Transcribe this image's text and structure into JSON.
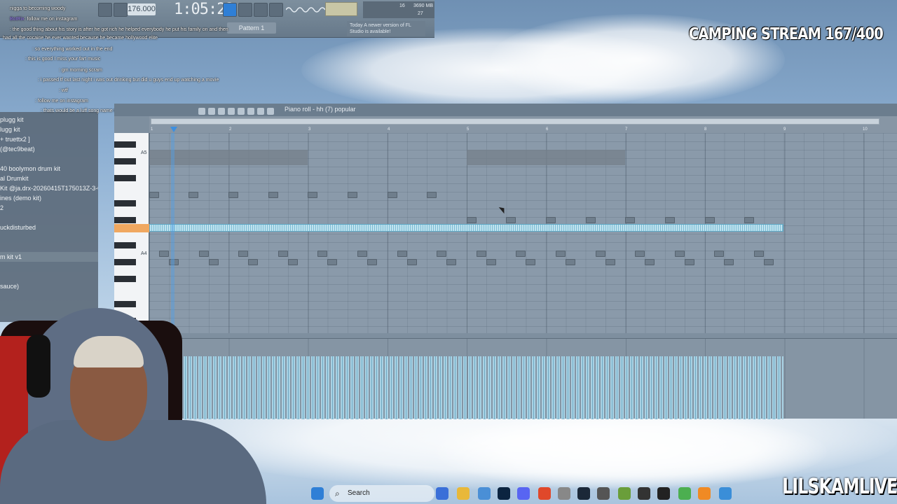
{
  "overlay": {
    "stream_title": "CAMPING STREAM 167/400",
    "watermark": "LILSKAMLIVE"
  },
  "toolbar": {
    "tempo": "176.000",
    "time": "1:05:22",
    "pattern_label": "Pattern 1",
    "cpu_voices": "16",
    "cpu_mem": "3690 MB",
    "cpu_poly": "27",
    "news_date": "Today",
    "news_text": "A newer version of FL Studio is available!"
  },
  "chat": [
    {
      "text": "nigga to becoming woody"
    },
    {
      "user": "BotRix",
      "text": ": follow me on instagram"
    },
    {
      "user": "",
      "text": ": the good thing about his story is after he got rich he helped everybody he put his family on and then"
    },
    {
      "user": "",
      "text": "had all the cocaine he ever wanted because he became hollywood elite"
    },
    {
      "user": "",
      "text": ": so everything worked out in the end"
    },
    {
      "user": "",
      "text": ": this is good I miss your fart music"
    },
    {
      "user": "",
      "text": ": gm morning scram"
    },
    {
      "user": "",
      "text": ": i passed tf out last night i was out drinking but did u guys end up watching a movie"
    },
    {
      "user": "",
      "text": ": wtf"
    },
    {
      "user": "",
      "text": ": follow me on instagram"
    },
    {
      "user": "",
      "text": ": thats would be a luff song name tool im broke my sex robots"
    }
  ],
  "browser": {
    "items": [
      {
        "label": "plugg kit"
      },
      {
        "label": "lugg kit"
      },
      {
        "label": "+ truettx2 ]"
      },
      {
        "label": "(@tec9beat)"
      },
      {
        "label": "40 boolymon drum kit"
      },
      {
        "label": "al Drumkit"
      },
      {
        "label": "Kit @ja.drx-20260415T175013Z-3-001"
      },
      {
        "label": "ines (demo kit)"
      },
      {
        "label": "2"
      },
      {
        "label": "uckdisturbed"
      },
      {
        "label": "m kit v1"
      },
      {
        "label": "sauce)"
      }
    ]
  },
  "piano_roll": {
    "title": "Piano roll - hh (7) popular",
    "bar_numbers": [
      "1",
      "2",
      "3",
      "4",
      "5",
      "6",
      "7",
      "8",
      "9",
      "10"
    ],
    "key_labels": {
      "upper": "A5",
      "lower": "A4"
    }
  },
  "taskbar": {
    "search_label": "Search"
  },
  "colors": {
    "selected_note": "#bfe3f0",
    "playhead": "#3d8fe0",
    "highlight_key": "#f0a860"
  }
}
